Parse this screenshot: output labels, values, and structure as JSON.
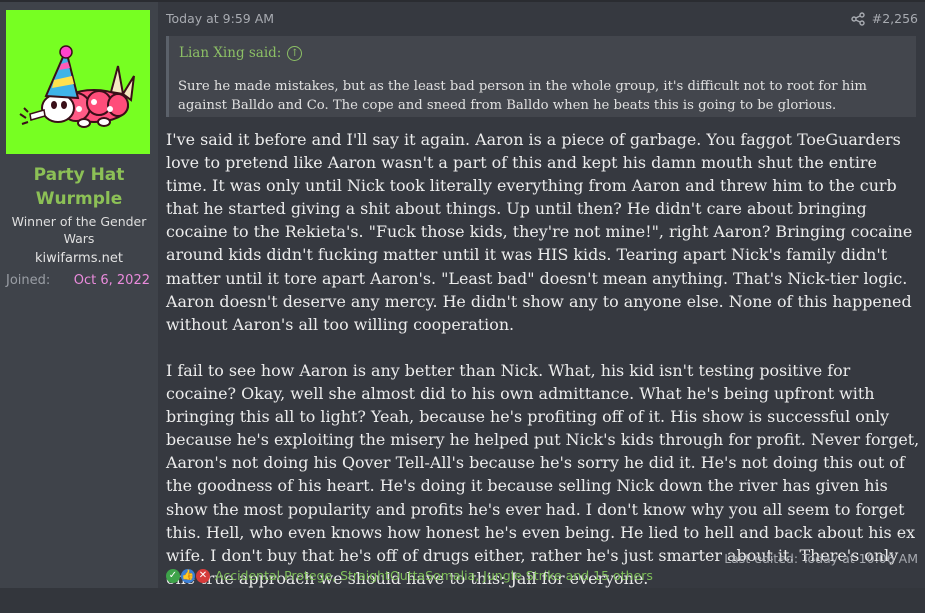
{
  "user": {
    "name": "Party Hat Wurmple",
    "title": "Winner of the Gender Wars",
    "banner": "kiwifarms.net",
    "joined_label": "Joined:",
    "joined_date": "Oct 6, 2022"
  },
  "post": {
    "date": "Today at 9:59 AM",
    "number": "#2,256",
    "quote": {
      "author": "Lian Xing said:",
      "text": "Sure he made mistakes, but as the least bad person in the whole group, it's difficult not to root for him against Balldo and Co. The cope and sneed from Balldo when he beats this is going to be glorious."
    },
    "paragraphs": [
      "I've said it before and I'll say it again. Aaron is a piece of garbage. You faggot ToeGuarders love to pretend like Aaron wasn't a part of this and kept his damn mouth shut the entire time. It was only until Nick took literally everything from Aaron and threw him to the curb that he started giving a shit about things. Up until then? He didn't care about bringing cocaine to the Rekieta's. \"Fuck those kids, they're not mine!\", right Aaron? Bringing cocaine around kids didn't fucking matter until it was HIS kids. Tearing apart Nick's family didn't matter until it tore apart Aaron's. \"Least bad\" doesn't mean anything. That's Nick-tier logic. Aaron doesn't deserve any mercy. He didn't show any to anyone else. None of this happened without Aaron's all too willing cooperation.",
      "I fail to see how Aaron is any better than Nick. What, his kid isn't testing positive for cocaine? Okay, well she almost did to his own admittance. What he's being upfront with bringing this all to light? Yeah, because he's profiting off of it. His show is successful only because he's exploiting the misery he helped put Nick's kids through for profit. Never forget, Aaron's not doing his Qover Tell-All's because he's sorry he did it. He's not doing this out of the goodness of his heart. He's doing it because selling Nick down the river has given his show the most popularity and profits he's ever had. I don't know why you all seem to forget this. Hell, who even knows how honest he's even being. He lied to hell and back about his ex wife. I don't buy that he's off of drugs either, rather he's just smarter about it. There's only one true approach we should have to this: Jail for everyone."
    ],
    "last_edited": "Last edited: Today at 10:06 AM",
    "reactions": {
      "icons": [
        "check-reaction-icon",
        "thumbs-up-reaction-icon",
        "x-reaction-icon"
      ],
      "users_text": "Accidental Protege, StraightOuttaSomalia, Jungle Strike and 15 others"
    }
  },
  "colors": {
    "username": "#8cc056",
    "joined_date": "#ea8bdc",
    "quote_author": "#8cbf65",
    "avatar_bg": "#77ff22"
  }
}
